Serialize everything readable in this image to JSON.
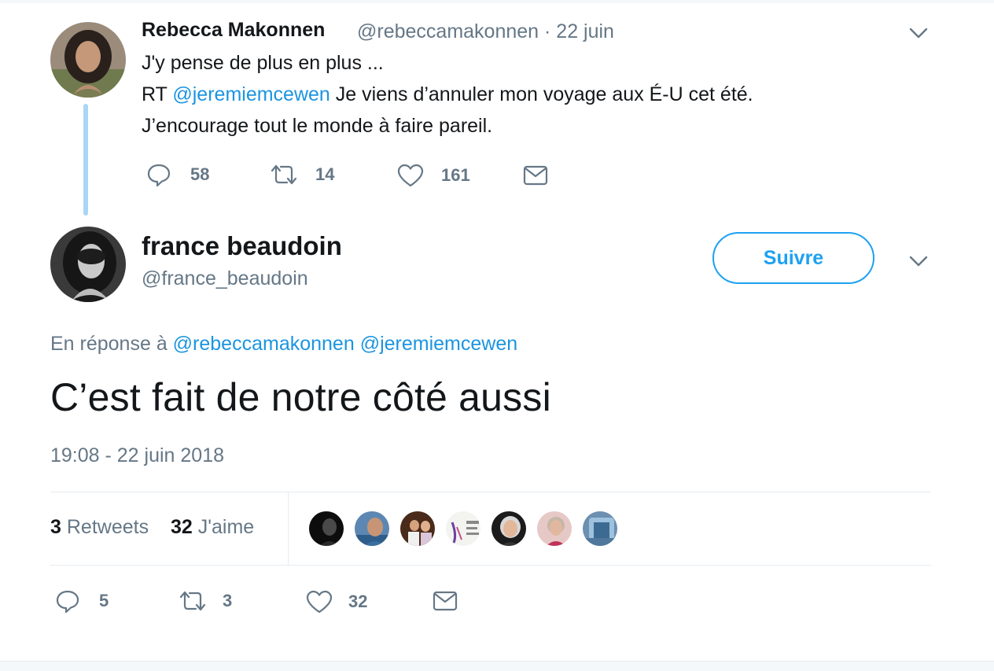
{
  "parent_tweet": {
    "author_name": "Rebecca Makonnen",
    "meta": "@rebeccamakonnen · 22 juin",
    "line1": "J'y pense de plus en plus ...",
    "line2_prefix": "RT",
    "line2_mention": "@jeremiemcewen",
    "line2_rest": "Je viens d’annuler mon voyage aux É-U cet été.",
    "line3": "J’encourage tout le monde à faire pareil.",
    "actions": {
      "replies": "58",
      "retweets": "14",
      "likes": "161"
    }
  },
  "main_tweet": {
    "author_name": "france beaudoin",
    "author_handle": "@france_beaudoin",
    "follow_label": "Suivre",
    "reply_prefix": "En réponse à",
    "reply_mention_1": "@rebeccamakonnen",
    "reply_mention_2": "@jeremiemcewen",
    "text": "C’est fait de notre côté aussi",
    "timestamp": "19:08 - 22 juin 2018",
    "stats": {
      "retweets_count": "3",
      "retweets_label": "Retweets",
      "likes_count": "32",
      "likes_label": "J'aime"
    },
    "actions": {
      "replies": "5",
      "retweets": "3",
      "likes": "32"
    }
  },
  "icons": {
    "reply": "speech-bubble-icon",
    "retweet": "retweet-arrows-icon",
    "like": "heart-icon",
    "dm": "envelope-icon",
    "caret": "chevron-down-icon"
  },
  "colors": {
    "link": "#1b95e0",
    "accent": "#1da1f2",
    "secondary_text": "#657786",
    "thread_line": "#a9d6f6",
    "divider": "#e6ecf0"
  }
}
